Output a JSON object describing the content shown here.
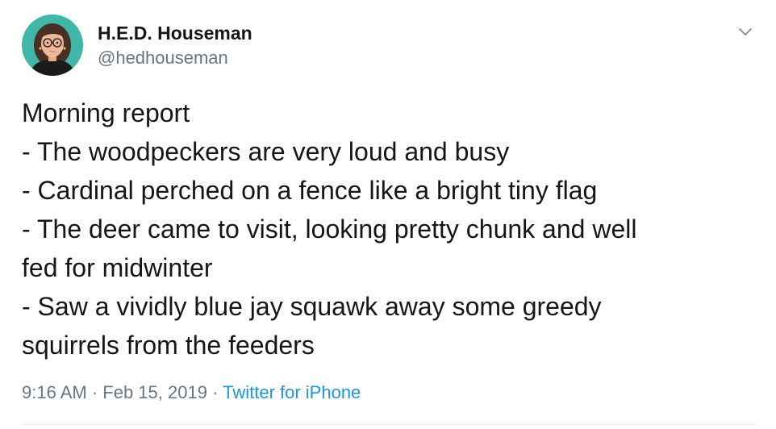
{
  "author": {
    "name": "H.E.D. Houseman",
    "handle": "@hedhouseman",
    "avatar_icon": "profile-illustration-avatar"
  },
  "tweet": {
    "lines": [
      "Morning report",
      "- The woodpeckers are very loud and busy",
      "- Cardinal perched on a fence like a bright tiny flag",
      "- The deer came to visit, looking pretty chunk and well",
      "fed for midwinter",
      "- Saw a vividly blue jay squawk away some greedy",
      "squirrels from the feeders"
    ]
  },
  "meta": {
    "time": "9:16 AM",
    "sep1": " · ",
    "date": "Feb 15, 2019",
    "sep2": " · ",
    "source": "Twitter for iPhone"
  },
  "menu": {
    "icon": "chevron-down-icon"
  },
  "colors": {
    "text": "#14171a",
    "secondary": "#657786",
    "link": "#1b95e0",
    "avatar_bg": "#3fb8a9",
    "divider": "#e6ecf0"
  }
}
